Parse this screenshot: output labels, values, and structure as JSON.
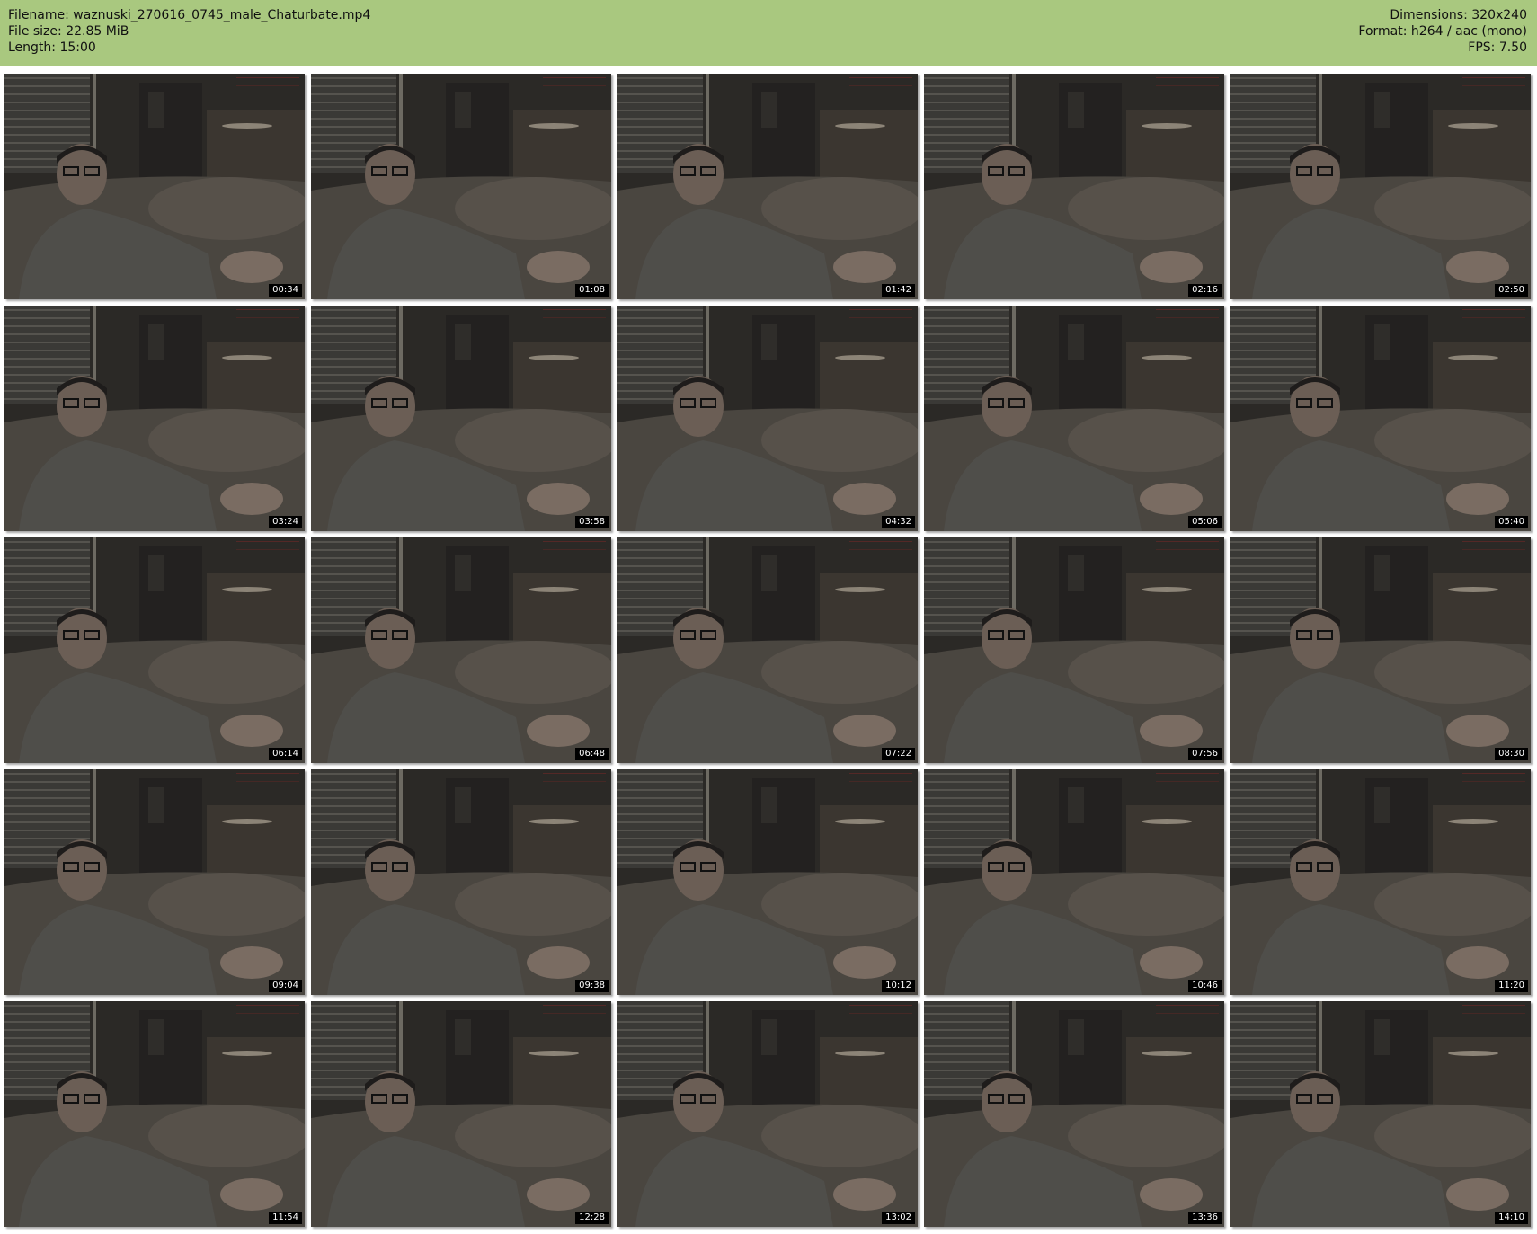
{
  "header": {
    "filename_line": "Filename: waznuski_270616_0745_male_Chaturbate.mp4",
    "filesize_line": "File size: 22.85 MiB",
    "length_line": "Length: 15:00",
    "dimensions_line": "Dimensions: 320x240",
    "format_line": "Format: h264 / aac (mono)",
    "fps_line": "FPS: 7.50",
    "background_color": "#a9c87f"
  },
  "thumbnails": [
    {
      "time": "00:34"
    },
    {
      "time": "01:08"
    },
    {
      "time": "01:42"
    },
    {
      "time": "02:16"
    },
    {
      "time": "02:50"
    },
    {
      "time": "03:24"
    },
    {
      "time": "03:58"
    },
    {
      "time": "04:32"
    },
    {
      "time": "05:06"
    },
    {
      "time": "05:40"
    },
    {
      "time": "06:14"
    },
    {
      "time": "06:48"
    },
    {
      "time": "07:22"
    },
    {
      "time": "07:56"
    },
    {
      "time": "08:30"
    },
    {
      "time": "09:04"
    },
    {
      "time": "09:38"
    },
    {
      "time": "10:12"
    },
    {
      "time": "10:46"
    },
    {
      "time": "11:20"
    },
    {
      "time": "11:54"
    },
    {
      "time": "12:28"
    },
    {
      "time": "13:02"
    },
    {
      "time": "13:36"
    },
    {
      "time": "14:10"
    }
  ]
}
